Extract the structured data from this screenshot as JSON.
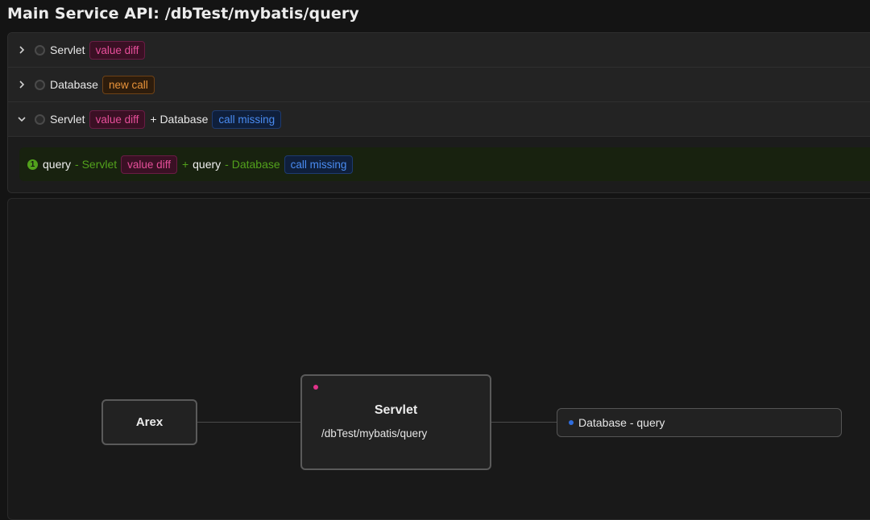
{
  "page": {
    "title": "Main Service API: /dbTest/mybatis/query"
  },
  "scenarios": [
    {
      "expanded": false,
      "label": "Servlet",
      "tag": "value diff",
      "tag_color": "#e64f9a"
    },
    {
      "expanded": false,
      "label": "Database",
      "tag": "new call",
      "tag_color": "#e8933a"
    },
    {
      "expanded": true,
      "label": "Servlet",
      "tag": "value diff",
      "plus": "+ Database",
      "tag2": "call missing",
      "tag2_color": "#4a8cf2"
    }
  ],
  "detail": {
    "index": "1",
    "item1": "query",
    "item1_sep": "- Servlet",
    "item1_tag": "value diff",
    "plus": "+",
    "item2": "query",
    "item2_sep": "- Database",
    "item2_tag": "call missing"
  },
  "flow": {
    "arex": "Arex",
    "servlet_title": "Servlet",
    "servlet_path": "/dbTest/mybatis/query",
    "db_node": "Database - query"
  },
  "colors": {
    "accent_pink": "#e64f9a",
    "accent_orange": "#e8933a",
    "accent_blue": "#4a8cf2",
    "accent_green": "#52a11c"
  }
}
